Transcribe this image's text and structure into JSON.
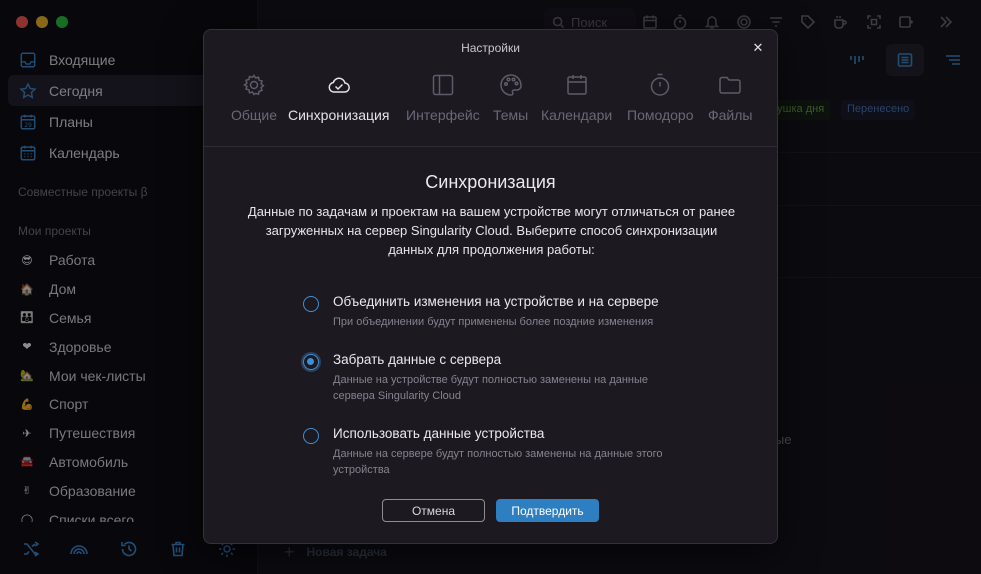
{
  "sidebar": {
    "nav": [
      {
        "label": "Входящие",
        "icon": "inbox-icon"
      },
      {
        "label": "Сегодня",
        "icon": "star-icon"
      },
      {
        "label": "Планы",
        "icon": "calendar-number-icon"
      },
      {
        "label": "Календарь",
        "icon": "calendar-grid-icon"
      }
    ],
    "shared_title": "Совместные проекты β",
    "projects_title": "Мои проекты",
    "projects": [
      {
        "label": "Работа",
        "emoji": "😎",
        "bar": "#f5b400"
      },
      {
        "label": "Дом",
        "emoji": "🏠",
        "bar": "#d04a3b"
      },
      {
        "label": "Семья",
        "emoji": "👪",
        "bar": "#e07b39"
      },
      {
        "label": "Здоровье",
        "emoji": "❤",
        "bar": "#d23a3a"
      },
      {
        "label": "Мои чек-листы",
        "emoji": "🏡",
        "bar": "#9a9a9a"
      },
      {
        "label": "Спорт",
        "emoji": "💪",
        "bar": "#3aa050"
      },
      {
        "label": "Путешествия",
        "emoji": "✈",
        "bar": "#9d3ac0"
      },
      {
        "label": "Автомобиль",
        "emoji": "🚘",
        "bar": "#3a7fd6"
      },
      {
        "label": "Образование",
        "emoji": "✌",
        "bar": "#c9c33a"
      },
      {
        "label": "Списки всего",
        "emoji": "◯",
        "bar": "#3aa050"
      }
    ],
    "bottom_icons": [
      "shuffle-icon",
      "rainbow-icon",
      "history-icon",
      "trash-icon",
      "settings-gear-icon"
    ]
  },
  "toolbar": {
    "search_placeholder": "Поиск"
  },
  "main": {
    "tag_day": "тушка дня",
    "tag_moved": "Перенесено",
    "text_partial": "вые",
    "new_task": "Новая задача"
  },
  "modal": {
    "title": "Настройки",
    "close_label": "✕",
    "tabs": [
      {
        "label": "Общие",
        "icon": "gear-icon"
      },
      {
        "label": "Синхронизация",
        "icon": "cloud-check-icon",
        "active": true
      },
      {
        "label": "Интерфейс",
        "icon": "layout-icon"
      },
      {
        "label": "Темы",
        "icon": "palette-icon"
      },
      {
        "label": "Календари",
        "icon": "calendar-icon"
      },
      {
        "label": "Помодоро",
        "icon": "stopwatch-icon"
      },
      {
        "label": "Файлы",
        "icon": "folder-icon"
      }
    ],
    "heading": "Синхронизация",
    "description": "Данные по задачам и проектам на вашем устройстве могут отличаться от ранее загруженных на сервер Singularity Cloud. Выберите способ синхронизации данных для продолжения работы:",
    "options": [
      {
        "title": "Объединить изменения на устройстве и на сервере",
        "desc": "При объединении будут применены более поздние изменения",
        "checked": false
      },
      {
        "title": "Забрать данные с сервера",
        "desc": "Данные на устройстве будут полностью заменены на данные сервера Singularity Cloud",
        "checked": true
      },
      {
        "title": "Использовать данные устройства",
        "desc": "Данные на сервере будут полностью заменены на данные этого устройства",
        "checked": false
      }
    ],
    "cancel_label": "Отмена",
    "confirm_label": "Подтвердить"
  },
  "colors": {
    "accent": "#3f8fd6",
    "confirm": "#2d7fc1",
    "modal_bg": "#1c1921",
    "sidebar_bg": "#0f0d14"
  }
}
